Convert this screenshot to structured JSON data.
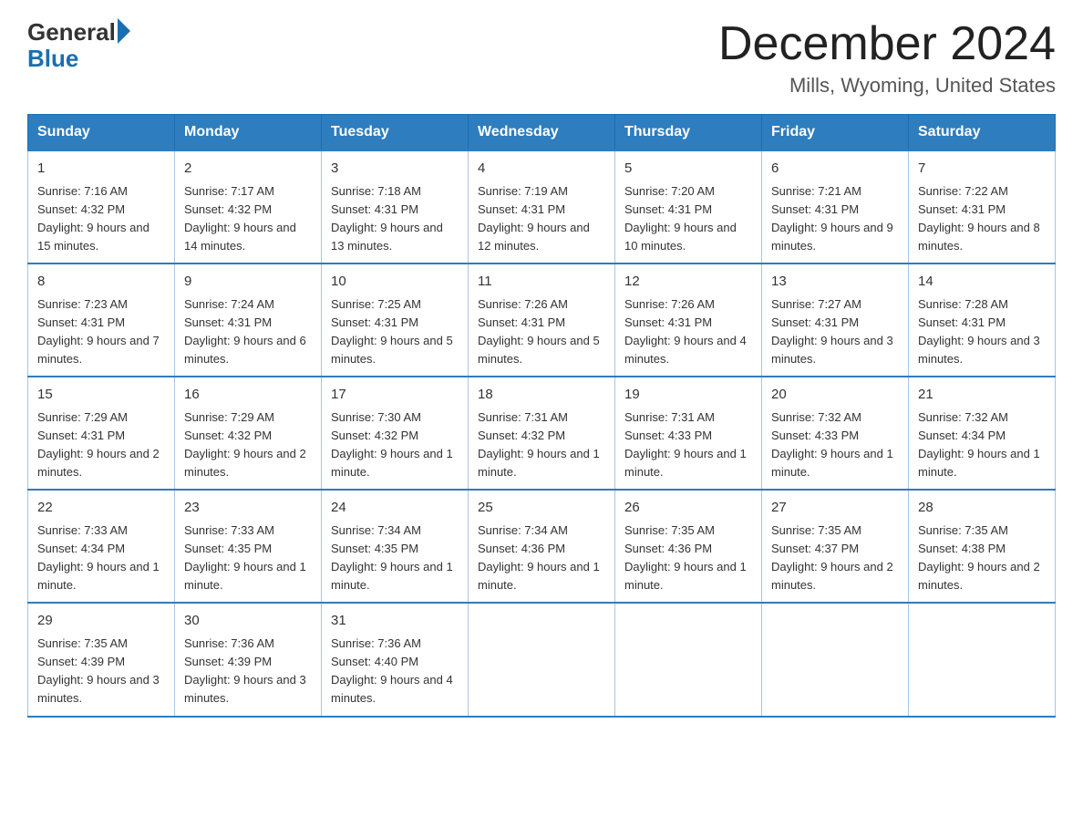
{
  "header": {
    "logo_general": "General",
    "logo_blue": "Blue",
    "month_title": "December 2024",
    "location": "Mills, Wyoming, United States"
  },
  "days_of_week": [
    "Sunday",
    "Monday",
    "Tuesday",
    "Wednesday",
    "Thursday",
    "Friday",
    "Saturday"
  ],
  "weeks": [
    [
      {
        "day": "1",
        "sunrise": "7:16 AM",
        "sunset": "4:32 PM",
        "daylight": "9 hours and 15 minutes."
      },
      {
        "day": "2",
        "sunrise": "7:17 AM",
        "sunset": "4:32 PM",
        "daylight": "9 hours and 14 minutes."
      },
      {
        "day": "3",
        "sunrise": "7:18 AM",
        "sunset": "4:31 PM",
        "daylight": "9 hours and 13 minutes."
      },
      {
        "day": "4",
        "sunrise": "7:19 AM",
        "sunset": "4:31 PM",
        "daylight": "9 hours and 12 minutes."
      },
      {
        "day": "5",
        "sunrise": "7:20 AM",
        "sunset": "4:31 PM",
        "daylight": "9 hours and 10 minutes."
      },
      {
        "day": "6",
        "sunrise": "7:21 AM",
        "sunset": "4:31 PM",
        "daylight": "9 hours and 9 minutes."
      },
      {
        "day": "7",
        "sunrise": "7:22 AM",
        "sunset": "4:31 PM",
        "daylight": "9 hours and 8 minutes."
      }
    ],
    [
      {
        "day": "8",
        "sunrise": "7:23 AM",
        "sunset": "4:31 PM",
        "daylight": "9 hours and 7 minutes."
      },
      {
        "day": "9",
        "sunrise": "7:24 AM",
        "sunset": "4:31 PM",
        "daylight": "9 hours and 6 minutes."
      },
      {
        "day": "10",
        "sunrise": "7:25 AM",
        "sunset": "4:31 PM",
        "daylight": "9 hours and 5 minutes."
      },
      {
        "day": "11",
        "sunrise": "7:26 AM",
        "sunset": "4:31 PM",
        "daylight": "9 hours and 5 minutes."
      },
      {
        "day": "12",
        "sunrise": "7:26 AM",
        "sunset": "4:31 PM",
        "daylight": "9 hours and 4 minutes."
      },
      {
        "day": "13",
        "sunrise": "7:27 AM",
        "sunset": "4:31 PM",
        "daylight": "9 hours and 3 minutes."
      },
      {
        "day": "14",
        "sunrise": "7:28 AM",
        "sunset": "4:31 PM",
        "daylight": "9 hours and 3 minutes."
      }
    ],
    [
      {
        "day": "15",
        "sunrise": "7:29 AM",
        "sunset": "4:31 PM",
        "daylight": "9 hours and 2 minutes."
      },
      {
        "day": "16",
        "sunrise": "7:29 AM",
        "sunset": "4:32 PM",
        "daylight": "9 hours and 2 minutes."
      },
      {
        "day": "17",
        "sunrise": "7:30 AM",
        "sunset": "4:32 PM",
        "daylight": "9 hours and 1 minute."
      },
      {
        "day": "18",
        "sunrise": "7:31 AM",
        "sunset": "4:32 PM",
        "daylight": "9 hours and 1 minute."
      },
      {
        "day": "19",
        "sunrise": "7:31 AM",
        "sunset": "4:33 PM",
        "daylight": "9 hours and 1 minute."
      },
      {
        "day": "20",
        "sunrise": "7:32 AM",
        "sunset": "4:33 PM",
        "daylight": "9 hours and 1 minute."
      },
      {
        "day": "21",
        "sunrise": "7:32 AM",
        "sunset": "4:34 PM",
        "daylight": "9 hours and 1 minute."
      }
    ],
    [
      {
        "day": "22",
        "sunrise": "7:33 AM",
        "sunset": "4:34 PM",
        "daylight": "9 hours and 1 minute."
      },
      {
        "day": "23",
        "sunrise": "7:33 AM",
        "sunset": "4:35 PM",
        "daylight": "9 hours and 1 minute."
      },
      {
        "day": "24",
        "sunrise": "7:34 AM",
        "sunset": "4:35 PM",
        "daylight": "9 hours and 1 minute."
      },
      {
        "day": "25",
        "sunrise": "7:34 AM",
        "sunset": "4:36 PM",
        "daylight": "9 hours and 1 minute."
      },
      {
        "day": "26",
        "sunrise": "7:35 AM",
        "sunset": "4:36 PM",
        "daylight": "9 hours and 1 minute."
      },
      {
        "day": "27",
        "sunrise": "7:35 AM",
        "sunset": "4:37 PM",
        "daylight": "9 hours and 2 minutes."
      },
      {
        "day": "28",
        "sunrise": "7:35 AM",
        "sunset": "4:38 PM",
        "daylight": "9 hours and 2 minutes."
      }
    ],
    [
      {
        "day": "29",
        "sunrise": "7:35 AM",
        "sunset": "4:39 PM",
        "daylight": "9 hours and 3 minutes."
      },
      {
        "day": "30",
        "sunrise": "7:36 AM",
        "sunset": "4:39 PM",
        "daylight": "9 hours and 3 minutes."
      },
      {
        "day": "31",
        "sunrise": "7:36 AM",
        "sunset": "4:40 PM",
        "daylight": "9 hours and 4 minutes."
      },
      null,
      null,
      null,
      null
    ]
  ]
}
